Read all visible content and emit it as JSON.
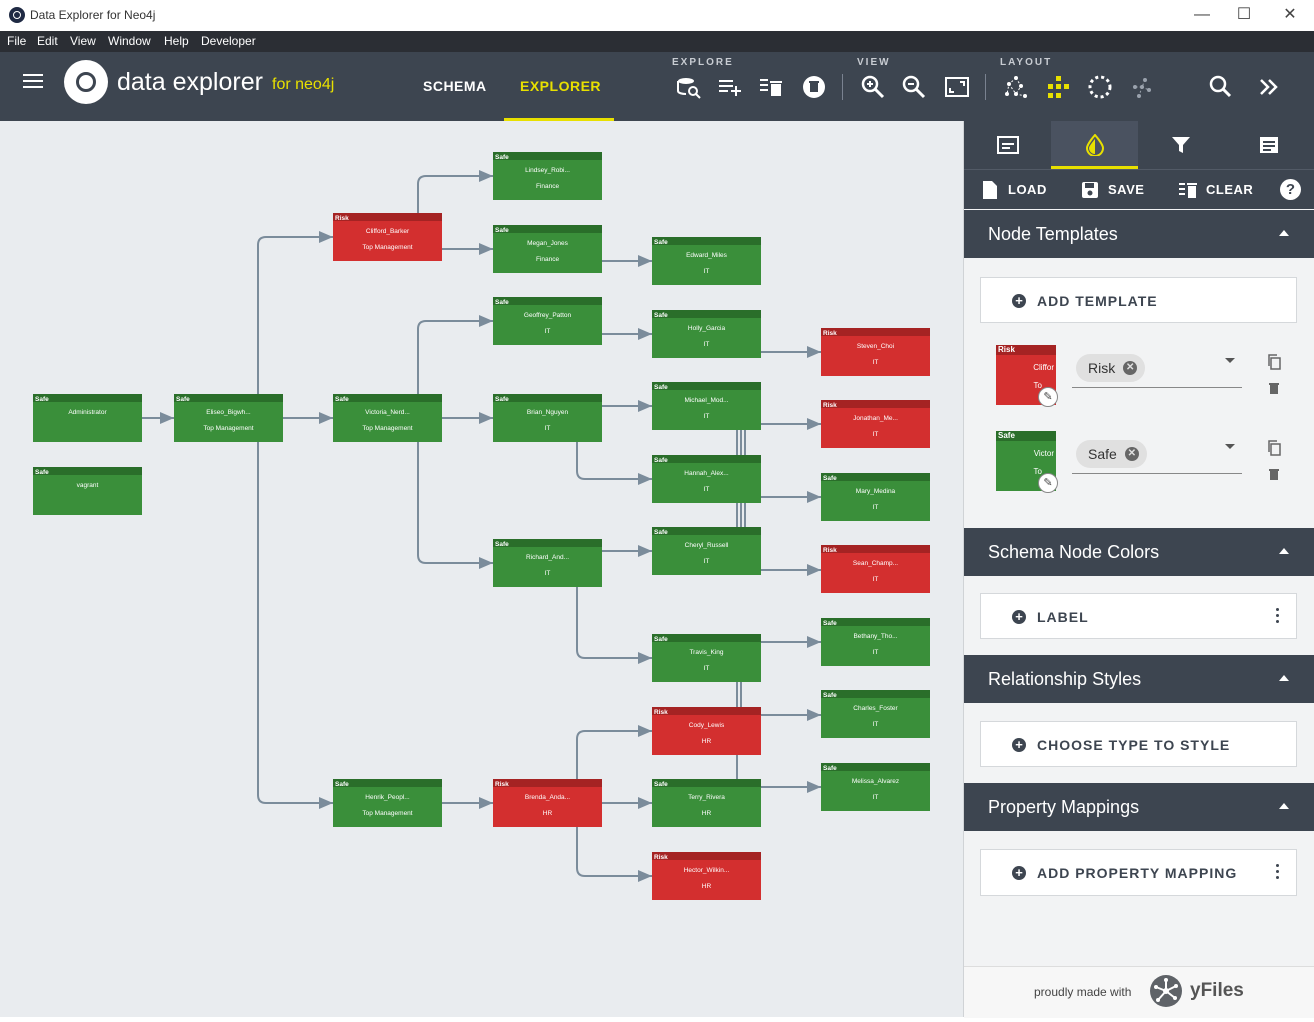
{
  "window": {
    "title": "Data Explorer for Neo4j",
    "controls": [
      "—",
      "☐",
      "✕"
    ]
  },
  "menu": [
    "File",
    "Edit",
    "View",
    "Window",
    "Help",
    "Developer"
  ],
  "header": {
    "brand": "data explorer",
    "brand_sub": "for neo4j",
    "tabs": [
      {
        "label": "SCHEMA",
        "active": false
      },
      {
        "label": "EXPLORER",
        "active": true
      }
    ],
    "groups": {
      "explore": "EXPLORE",
      "view": "VIEW",
      "layout": "LAYOUT"
    },
    "accent": "#e8e000"
  },
  "graph": {
    "colors": {
      "safe": "#3a8f3a",
      "safe_bar": "#2a6e2a",
      "risk": "#d32f2f",
      "risk_bar": "#a52323",
      "edge": "#7b8c9b"
    },
    "nodes": [
      {
        "id": "lindsey",
        "status": "Safe",
        "name": "Lindsey_Robi...",
        "dept": "Finance"
      },
      {
        "id": "clifford",
        "status": "Risk",
        "name": "Clifford_Barker",
        "dept": "Top Management"
      },
      {
        "id": "megan",
        "status": "Safe",
        "name": "Megan_Jones",
        "dept": "Finance"
      },
      {
        "id": "edward",
        "status": "Safe",
        "name": "Edward_Miles",
        "dept": "IT"
      },
      {
        "id": "geoffrey",
        "status": "Safe",
        "name": "Geoffrey_Patton",
        "dept": "IT"
      },
      {
        "id": "holly",
        "status": "Safe",
        "name": "Holly_Garcia",
        "dept": "IT"
      },
      {
        "id": "steven",
        "status": "Risk",
        "name": "Steven_Choi",
        "dept": "IT"
      },
      {
        "id": "admin",
        "status": "Safe",
        "name": "Administrator",
        "dept": ""
      },
      {
        "id": "eliseo",
        "status": "Safe",
        "name": "Eliseo_Bigwh...",
        "dept": "Top Management"
      },
      {
        "id": "victoria",
        "status": "Safe",
        "name": "Victoria_Nerd...",
        "dept": "Top Management"
      },
      {
        "id": "brian",
        "status": "Safe",
        "name": "Brian_Nguyen",
        "dept": "IT"
      },
      {
        "id": "michael",
        "status": "Safe",
        "name": "Michael_Mod...",
        "dept": "IT"
      },
      {
        "id": "jonathan",
        "status": "Risk",
        "name": "Jonathan_Me...",
        "dept": "IT"
      },
      {
        "id": "vagrant",
        "status": "Safe",
        "name": "vagrant",
        "dept": ""
      },
      {
        "id": "hannah",
        "status": "Safe",
        "name": "Hannah_Alex...",
        "dept": "IT"
      },
      {
        "id": "mary",
        "status": "Safe",
        "name": "Mary_Medina",
        "dept": "IT"
      },
      {
        "id": "richard",
        "status": "Safe",
        "name": "Richard_And...",
        "dept": "IT"
      },
      {
        "id": "cheryl",
        "status": "Safe",
        "name": "Cheryl_Russell",
        "dept": "IT"
      },
      {
        "id": "sean",
        "status": "Risk",
        "name": "Sean_Champ...",
        "dept": "IT"
      },
      {
        "id": "travis",
        "status": "Safe",
        "name": "Travis_King",
        "dept": "IT"
      },
      {
        "id": "bethany",
        "status": "Safe",
        "name": "Bethany_Tho...",
        "dept": "IT"
      },
      {
        "id": "cody",
        "status": "Risk",
        "name": "Cody_Lewis",
        "dept": "HR"
      },
      {
        "id": "charles",
        "status": "Safe",
        "name": "Charles_Foster",
        "dept": "IT"
      },
      {
        "id": "henrik",
        "status": "Safe",
        "name": "Henrik_Peopl...",
        "dept": "Top Management"
      },
      {
        "id": "brenda",
        "status": "Risk",
        "name": "Brenda_Anda...",
        "dept": "HR"
      },
      {
        "id": "terry",
        "status": "Safe",
        "name": "Terry_Rivera",
        "dept": "HR"
      },
      {
        "id": "melissa",
        "status": "Safe",
        "name": "Melissa_Alvarez",
        "dept": "IT"
      },
      {
        "id": "hector",
        "status": "Risk",
        "name": "Hector_Wilkin...",
        "dept": "HR"
      }
    ]
  },
  "panel": {
    "actions": {
      "load": "LOAD",
      "save": "SAVE",
      "clear": "CLEAR",
      "help": "?"
    },
    "node_templates": {
      "title": "Node Templates",
      "add_label": "ADD TEMPLATE",
      "templates": [
        {
          "status": "Risk",
          "preview_text": "Cliffor",
          "preview_text2": "To",
          "chip": "Risk"
        },
        {
          "status": "Safe",
          "preview_text": "Victor",
          "preview_text2": "To",
          "chip": "Safe"
        }
      ]
    },
    "schema_colors": {
      "title": "Schema Node Colors",
      "add_label": "LABEL"
    },
    "relationship_styles": {
      "title": "Relationship Styles",
      "add_label": "CHOOSE TYPE TO STYLE"
    },
    "property_mappings": {
      "title": "Property Mappings",
      "add_label": "ADD PROPERTY MAPPING"
    },
    "footer": {
      "text": "proudly made with",
      "brand": "yFiles"
    }
  }
}
